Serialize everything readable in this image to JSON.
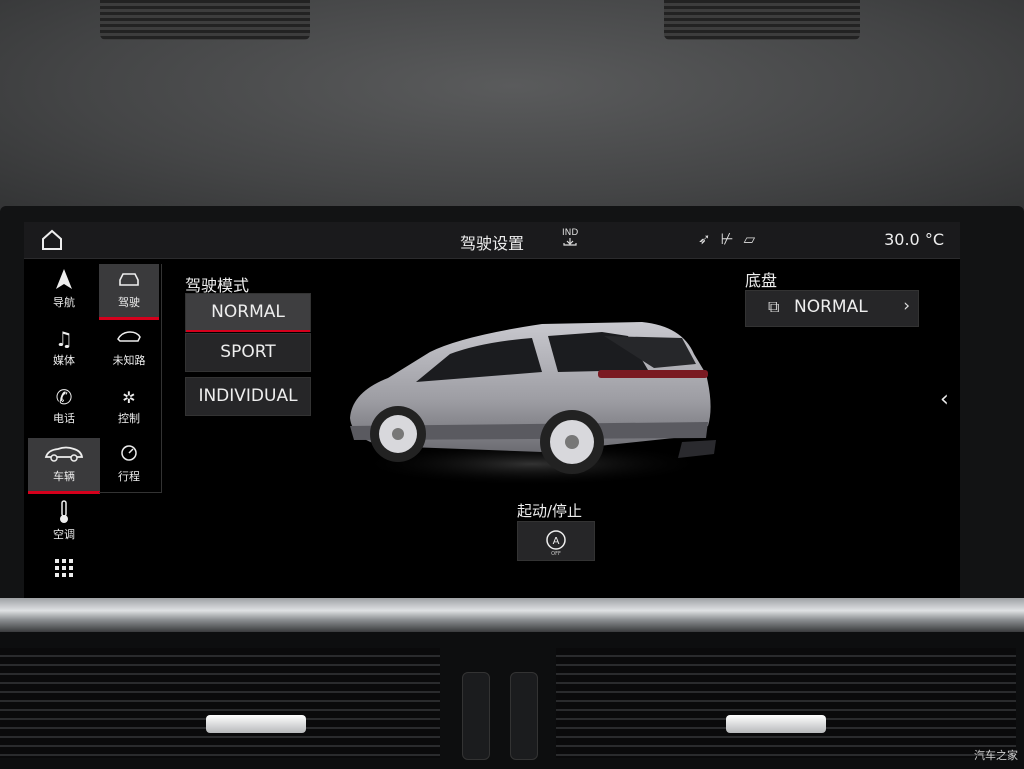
{
  "header": {
    "title": "驾驶设置",
    "ind_label": "IND",
    "temperature": "30.0 °C"
  },
  "left_nav": [
    {
      "label": "导航",
      "icon": "navigation-arrow-icon"
    },
    {
      "label": "媒体",
      "icon": "music-note-icon"
    },
    {
      "label": "电话",
      "icon": "phone-icon"
    },
    {
      "label": "车辆",
      "icon": "car-side-icon",
      "active": true
    },
    {
      "label": "空调",
      "icon": "thermometer-icon"
    },
    {
      "label": "",
      "icon": "apps-grid-icon"
    }
  ],
  "sub_nav": [
    {
      "label": "驾驶",
      "icon": "car-front-icon",
      "active": true
    },
    {
      "label": "未知路",
      "icon": "offroad-car-icon"
    },
    {
      "label": "控制",
      "icon": "gear-icon"
    },
    {
      "label": "行程",
      "icon": "trip-gauge-icon"
    }
  ],
  "drive_mode": {
    "label": "驾驶模式",
    "options": [
      "NORMAL",
      "SPORT",
      "INDIVIDUAL"
    ],
    "selected": "NORMAL"
  },
  "chassis": {
    "label": "底盘",
    "value": "NORMAL"
  },
  "start_stop": {
    "label": "起动/停止",
    "icon_text": "A",
    "icon_sub": "OFF"
  },
  "watermark": "汽车之家",
  "colors": {
    "accent": "#d5001c",
    "background": "#000000",
    "button": "#262628"
  }
}
